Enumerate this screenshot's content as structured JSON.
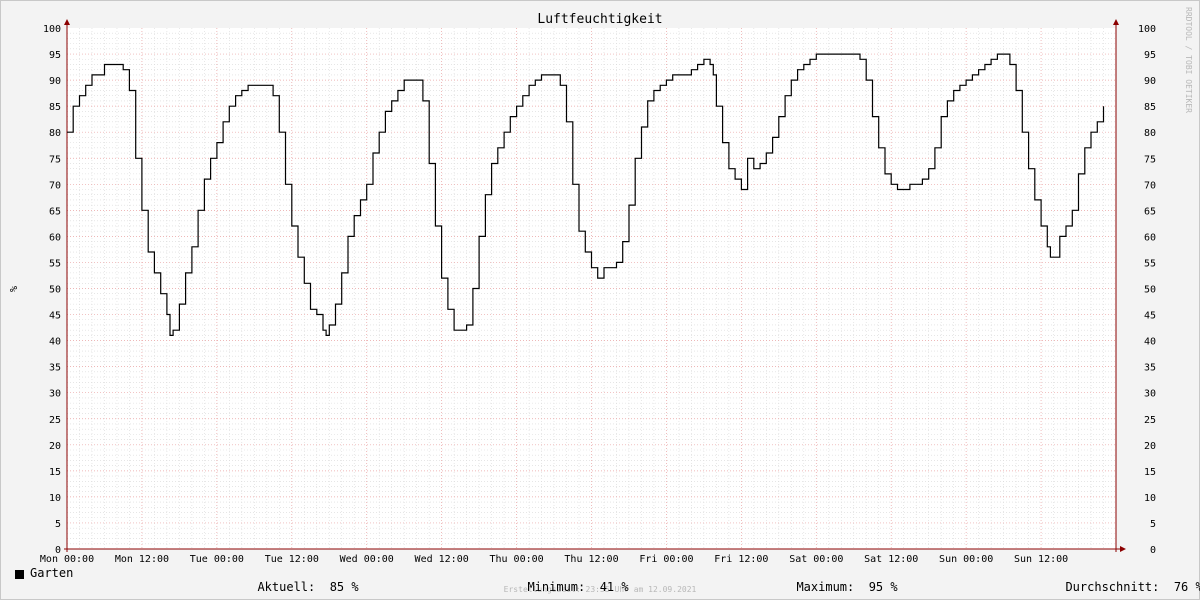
{
  "chart_data": {
    "type": "line",
    "title": "Luftfeuchtigkeit",
    "ylabel": "%",
    "ylim": [
      0,
      100
    ],
    "yticks": [
      0,
      5,
      10,
      15,
      20,
      25,
      30,
      35,
      40,
      45,
      50,
      55,
      60,
      65,
      70,
      75,
      80,
      85,
      90,
      95,
      100
    ],
    "xlim": [
      0,
      168
    ],
    "xtick_labels": [
      {
        "t": 0,
        "label": "Mon 00:00"
      },
      {
        "t": 12,
        "label": "Mon 12:00"
      },
      {
        "t": 24,
        "label": "Tue 00:00"
      },
      {
        "t": 36,
        "label": "Tue 12:00"
      },
      {
        "t": 48,
        "label": "Wed 00:00"
      },
      {
        "t": 60,
        "label": "Wed 12:00"
      },
      {
        "t": 72,
        "label": "Thu 00:00"
      },
      {
        "t": 84,
        "label": "Thu 12:00"
      },
      {
        "t": 96,
        "label": "Fri 00:00"
      },
      {
        "t": 108,
        "label": "Fri 12:00"
      },
      {
        "t": 120,
        "label": "Sat 00:00"
      },
      {
        "t": 132,
        "label": "Sat 12:00"
      },
      {
        "t": 144,
        "label": "Sun 00:00"
      },
      {
        "t": 156,
        "label": "Sun 12:00"
      }
    ],
    "grid": true,
    "series": [
      {
        "name": "Garten",
        "color": "#000000",
        "points": [
          [
            0,
            80
          ],
          [
            1,
            85
          ],
          [
            2,
            87
          ],
          [
            3,
            89
          ],
          [
            4,
            91
          ],
          [
            6,
            93
          ],
          [
            8,
            93
          ],
          [
            9,
            92
          ],
          [
            10,
            88
          ],
          [
            11,
            75
          ],
          [
            12,
            65
          ],
          [
            13,
            57
          ],
          [
            14,
            53
          ],
          [
            15,
            49
          ],
          [
            16,
            45
          ],
          [
            16.5,
            41
          ],
          [
            17,
            42
          ],
          [
            18,
            47
          ],
          [
            19,
            53
          ],
          [
            20,
            58
          ],
          [
            21,
            65
          ],
          [
            22,
            71
          ],
          [
            23,
            75
          ],
          [
            24,
            78
          ],
          [
            25,
            82
          ],
          [
            26,
            85
          ],
          [
            27,
            87
          ],
          [
            28,
            88
          ],
          [
            29,
            89
          ],
          [
            31,
            89
          ],
          [
            32,
            89
          ],
          [
            33,
            87
          ],
          [
            34,
            80
          ],
          [
            35,
            70
          ],
          [
            36,
            62
          ],
          [
            37,
            56
          ],
          [
            38,
            51
          ],
          [
            39,
            46
          ],
          [
            40,
            45
          ],
          [
            41,
            42
          ],
          [
            41.5,
            41
          ],
          [
            42,
            43
          ],
          [
            43,
            47
          ],
          [
            44,
            53
          ],
          [
            45,
            60
          ],
          [
            46,
            64
          ],
          [
            47,
            67
          ],
          [
            48,
            70
          ],
          [
            49,
            76
          ],
          [
            50,
            80
          ],
          [
            51,
            84
          ],
          [
            52,
            86
          ],
          [
            53,
            88
          ],
          [
            54,
            90
          ],
          [
            56,
            90
          ],
          [
            57,
            86
          ],
          [
            58,
            74
          ],
          [
            59,
            62
          ],
          [
            60,
            52
          ],
          [
            61,
            46
          ],
          [
            62,
            42
          ],
          [
            63,
            42
          ],
          [
            64,
            43
          ],
          [
            65,
            50
          ],
          [
            66,
            60
          ],
          [
            67,
            68
          ],
          [
            68,
            74
          ],
          [
            69,
            77
          ],
          [
            70,
            80
          ],
          [
            71,
            83
          ],
          [
            72,
            85
          ],
          [
            73,
            87
          ],
          [
            74,
            89
          ],
          [
            75,
            90
          ],
          [
            76,
            91
          ],
          [
            78,
            91
          ],
          [
            79,
            89
          ],
          [
            80,
            82
          ],
          [
            81,
            70
          ],
          [
            82,
            61
          ],
          [
            83,
            57
          ],
          [
            84,
            54
          ],
          [
            85,
            52
          ],
          [
            86,
            54
          ],
          [
            87,
            54
          ],
          [
            88,
            55
          ],
          [
            89,
            59
          ],
          [
            90,
            66
          ],
          [
            91,
            75
          ],
          [
            92,
            81
          ],
          [
            93,
            86
          ],
          [
            94,
            88
          ],
          [
            95,
            89
          ],
          [
            96,
            90
          ],
          [
            97,
            91
          ],
          [
            98,
            91
          ],
          [
            99,
            91
          ],
          [
            100,
            92
          ],
          [
            101,
            93
          ],
          [
            102,
            94
          ],
          [
            103,
            93
          ],
          [
            103.5,
            91
          ],
          [
            104,
            85
          ],
          [
            105,
            78
          ],
          [
            106,
            73
          ],
          [
            107,
            71
          ],
          [
            108,
            69
          ],
          [
            109,
            75
          ],
          [
            110,
            73
          ],
          [
            111,
            74
          ],
          [
            112,
            76
          ],
          [
            113,
            79
          ],
          [
            114,
            83
          ],
          [
            115,
            87
          ],
          [
            116,
            90
          ],
          [
            117,
            92
          ],
          [
            118,
            93
          ],
          [
            119,
            94
          ],
          [
            120,
            95
          ],
          [
            123,
            95
          ],
          [
            126,
            95
          ],
          [
            127,
            94
          ],
          [
            128,
            90
          ],
          [
            129,
            83
          ],
          [
            130,
            77
          ],
          [
            131,
            72
          ],
          [
            132,
            70
          ],
          [
            133,
            69
          ],
          [
            134,
            69
          ],
          [
            135,
            70
          ],
          [
            136,
            70
          ],
          [
            137,
            71
          ],
          [
            138,
            73
          ],
          [
            139,
            77
          ],
          [
            140,
            83
          ],
          [
            141,
            86
          ],
          [
            142,
            88
          ],
          [
            143,
            89
          ],
          [
            144,
            90
          ],
          [
            145,
            91
          ],
          [
            146,
            92
          ],
          [
            147,
            93
          ],
          [
            148,
            94
          ],
          [
            149,
            95
          ],
          [
            150,
            95
          ],
          [
            151,
            93
          ],
          [
            152,
            88
          ],
          [
            153,
            80
          ],
          [
            154,
            73
          ],
          [
            155,
            67
          ],
          [
            156,
            62
          ],
          [
            157,
            58
          ],
          [
            157.5,
            56
          ],
          [
            158,
            56
          ],
          [
            159,
            60
          ],
          [
            160,
            62
          ],
          [
            161,
            65
          ],
          [
            162,
            72
          ],
          [
            163,
            77
          ],
          [
            164,
            80
          ],
          [
            165,
            82
          ],
          [
            166,
            85
          ]
        ]
      }
    ],
    "legend": {
      "series_label": "Garten",
      "current_label": "Aktuell:",
      "current_value": "85 %",
      "min_label": "Minimum:",
      "min_value": "41 %",
      "max_label": "Maximum:",
      "max_value": "95 %",
      "avg_label": "Durchschnitt:",
      "avg_value": "76 %"
    },
    "footer": "Erstellungszeit: 23:55 Uhr am 12.09.2021",
    "watermark": "RRDTOOL / TOBI OETIKER",
    "colors": {
      "background": "#f3f3f3",
      "plot_background": "#ffffff",
      "major_grid": "#e9a0a0",
      "minor_grid": "#d8d8d8",
      "axis": "#8b0000",
      "line": "#000000"
    }
  }
}
